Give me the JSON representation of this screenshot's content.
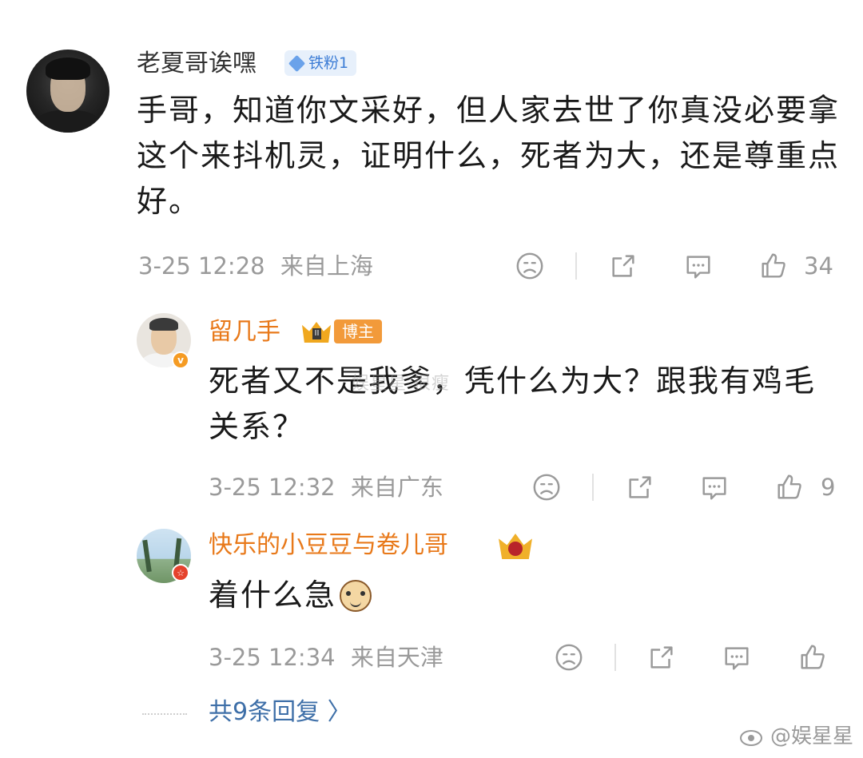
{
  "main_comment": {
    "username": "老夏哥诶嘿",
    "fan_badge": "铁粉1",
    "text": "手哥，知道你文采好，但人家去世了你真没必要拿这个来抖机灵，证明什么，死者为大，还是尊重点好。",
    "time": "3-25 12:28",
    "location": "来自上海",
    "likes": "34"
  },
  "replies": [
    {
      "username": "留几手",
      "crown_level": "II",
      "role_badge": "博主",
      "verified": "v",
      "text": "死者又不是我爹，凭什么为大？跟我有鸡毛关系？",
      "time": "3-25 12:32",
      "location": "来自广东",
      "likes": "9"
    },
    {
      "username": "快乐的小豆豆与卷儿哥",
      "verified": "☆",
      "text": "着什么急",
      "time": "3-25 12:34",
      "location": "来自天津",
      "likes": ""
    }
  ],
  "more_replies": "共9条回复 〉",
  "watermark_inline": "娱星星  很瘦",
  "footer_watermark": "@娱星星",
  "colors": {
    "username_host": "#e8791a",
    "meta_gray": "#9a9a9a",
    "link_blue": "#3e6fa8",
    "fan_badge_bg": "#e7f0fb"
  },
  "icons": [
    "dislike-face-icon",
    "share-icon",
    "comment-icon",
    "like-thumb-icon"
  ]
}
